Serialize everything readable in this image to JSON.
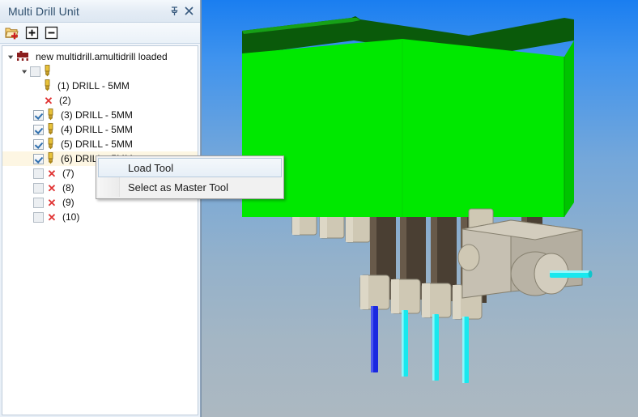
{
  "panel": {
    "title": "Multi Drill Unit",
    "titlebar_buttons": [
      {
        "name": "pin-icon",
        "glyph": "⚐"
      },
      {
        "name": "close-icon",
        "glyph": "×"
      }
    ],
    "toolbar": [
      {
        "name": "add-folder-button",
        "tip": "Load"
      },
      {
        "name": "expand-all-button",
        "tip": "Expand"
      },
      {
        "name": "collapse-all-button",
        "tip": "Collapse"
      }
    ],
    "tree": {
      "root_label": "new multidrill.amultidrill loaded",
      "nodes": [
        {
          "label": "",
          "indent": 1,
          "type": "checkbox-tool",
          "checked": false,
          "dim": true,
          "expander": "down",
          "selected": false
        },
        {
          "label": "(1) DRILL - 5MM",
          "indent": 2,
          "type": "tool",
          "checked": false,
          "dim": false,
          "expander": "",
          "selected": false
        },
        {
          "label": "(2)",
          "indent": 2,
          "type": "x",
          "checked": false,
          "dim": false,
          "expander": "",
          "selected": false
        },
        {
          "label": "(3) DRILL - 5MM",
          "indent": 1,
          "type": "checkbox-tool",
          "checked": true,
          "dim": false,
          "expander": "",
          "selected": false
        },
        {
          "label": "(4) DRILL - 5MM",
          "indent": 1,
          "type": "checkbox-tool",
          "checked": true,
          "dim": false,
          "expander": "",
          "selected": false
        },
        {
          "label": "(5) DRILL - 5MM",
          "indent": 1,
          "type": "checkbox-tool",
          "checked": true,
          "dim": false,
          "expander": "",
          "selected": false
        },
        {
          "label": "(6) DRILL - 5MM",
          "indent": 1,
          "type": "checkbox-tool",
          "checked": true,
          "dim": false,
          "expander": "",
          "selected": true
        },
        {
          "label": "(7)",
          "indent": 1,
          "type": "checkbox-x",
          "checked": false,
          "dim": true,
          "expander": "",
          "selected": false
        },
        {
          "label": "(8)",
          "indent": 1,
          "type": "checkbox-x",
          "checked": false,
          "dim": true,
          "expander": "",
          "selected": false
        },
        {
          "label": "(9)",
          "indent": 1,
          "type": "checkbox-x",
          "checked": false,
          "dim": true,
          "expander": "",
          "selected": false
        },
        {
          "label": "(10)",
          "indent": 1,
          "type": "checkbox-x",
          "checked": false,
          "dim": true,
          "expander": "",
          "selected": false
        }
      ]
    }
  },
  "context_menu": {
    "items": [
      {
        "label": "Load Tool",
        "hovered": true
      },
      {
        "label": "Select as Master Tool",
        "hovered": false
      }
    ]
  },
  "viewport": {
    "name": "3d-model-viewport",
    "colors": {
      "background_top": "#1a7ef0",
      "background_bottom": "#acb8c1",
      "body_front": "#00e800",
      "body_side": "#00c400",
      "body_top": "#0a5a0a",
      "collar": "#cfc8b4",
      "shaft": "#4a3f33",
      "housing": "#b4aea0",
      "tool_cyan": "#18e8ee",
      "tool_blue": "#1a28e0"
    }
  }
}
